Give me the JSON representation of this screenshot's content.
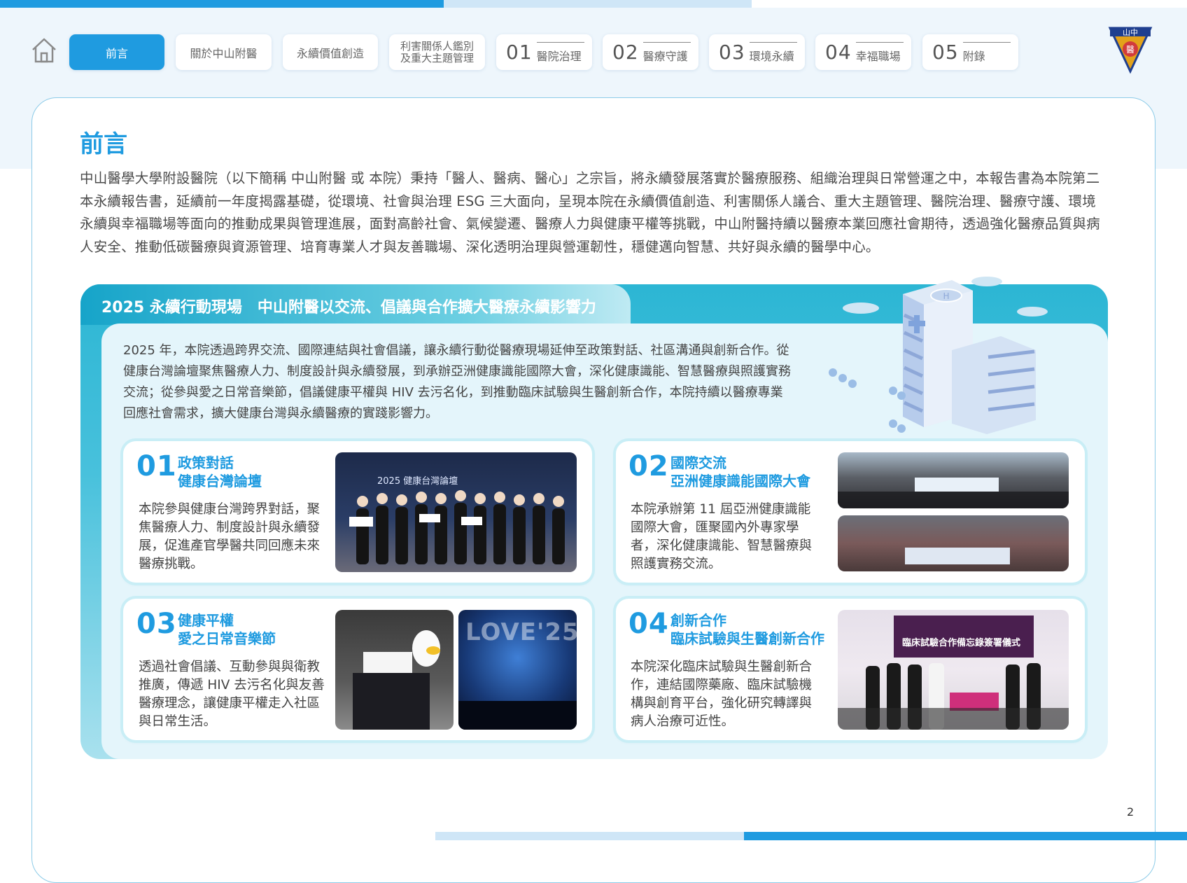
{
  "nav": {
    "tabs": [
      {
        "label": "前言",
        "active": true
      },
      {
        "label": "關於中山附醫"
      },
      {
        "label": "永續價值創造"
      },
      {
        "label_line1": "利害關係人鑑別",
        "label_line2": "及重大主題管理"
      },
      {
        "num": "01",
        "label": "醫院治理"
      },
      {
        "num": "02",
        "label": "醫療守護"
      },
      {
        "num": "03",
        "label": "環境永續"
      },
      {
        "num": "04",
        "label": "幸福職場"
      },
      {
        "num": "05",
        "label": "附錄"
      }
    ],
    "home_icon": "home-icon",
    "logo_text_top": "山中",
    "logo_text_mid": "醫",
    "accent": "#1f9be0"
  },
  "page": {
    "title": "前言",
    "intro": "中山醫學大學附設醫院（以下簡稱 中山附醫 或 本院）秉持「醫人、醫病、醫心」之宗旨，將永續發展落實於醫療服務、組織治理與日常營運之中，本報告書為本院第二本永續報告書，延續前一年度揭露基礎，從環境、社會與治理 ESG 三大面向，呈現本院在永續價值創造、利害關係人議合、重大主題管理、醫院治理、醫療守護、環境永續與幸福職場等面向的推動成果與管理進展，面對高齡社會、氣候變遷、醫療人力與健康平權等挑戰，中山附醫持續以醫療本業回應社會期待，透過強化醫療品質與病人安全、推動低碳醫療與資源管理、培育專業人才與友善職場、深化透明治理與營運韌性，穩健邁向智慧、共好與永續的醫學中心。",
    "page_number": "2"
  },
  "section": {
    "title": "2025 永續行動現場　中山附醫以交流、倡議與合作擴大醫療永續影響力",
    "text": "2025 年，本院透過跨界交流、國際連結與社會倡議，讓永續行動從醫療現場延伸至政策對話、社區溝通與創新合作。從健康台灣論壇聚焦醫療人力、制度設計與永續發展，到承辦亞洲健康識能國際大會，深化健康識能、智慧醫療與照護實務交流；從參與愛之日常音樂節，倡議健康平權與 HIV 去污名化，到推動臨床試驗與生醫創新合作，本院持續以醫療專業回應社會需求，擴大健康台灣與永續醫療的實踐影響力。",
    "cards": [
      {
        "num": "01",
        "head1": "政策對話",
        "head2": "健康台灣論壇",
        "text": "本院參與健康台灣跨界對話，聚焦醫療人力、制度設計與永續發展，促進產官學醫共同回應未來醫療挑戰。",
        "photo_banner": "2025 健康台灣論壇"
      },
      {
        "num": "02",
        "head1": "國際交流",
        "head2": "亞洲健康識能國際大會",
        "text": "本院承辦第 11 屆亞洲健康識能國際大會，匯聚國內外專家學者，深化健康識能、智慧醫療與照護實務交流。"
      },
      {
        "num": "03",
        "head1": "健康平權",
        "head2": "愛之日常音樂節",
        "text": "透過社會倡議、互動參與與衛教推廣，傳遞 HIV 去污名化與友善醫療理念，讓健康平權走入社區與日常生活。",
        "photo_banner": "LOVE'25"
      },
      {
        "num": "04",
        "head1": "創新合作",
        "head2": "臨床試驗與生醫創新合作",
        "text": "本院深化臨床試驗與生醫創新合作，連結國際藥廠、臨床試驗機構與創育平台，強化研究轉譯與病人治療可近性。",
        "photo_banner": "臨床試驗合作備忘錄簽署儀式"
      }
    ]
  }
}
